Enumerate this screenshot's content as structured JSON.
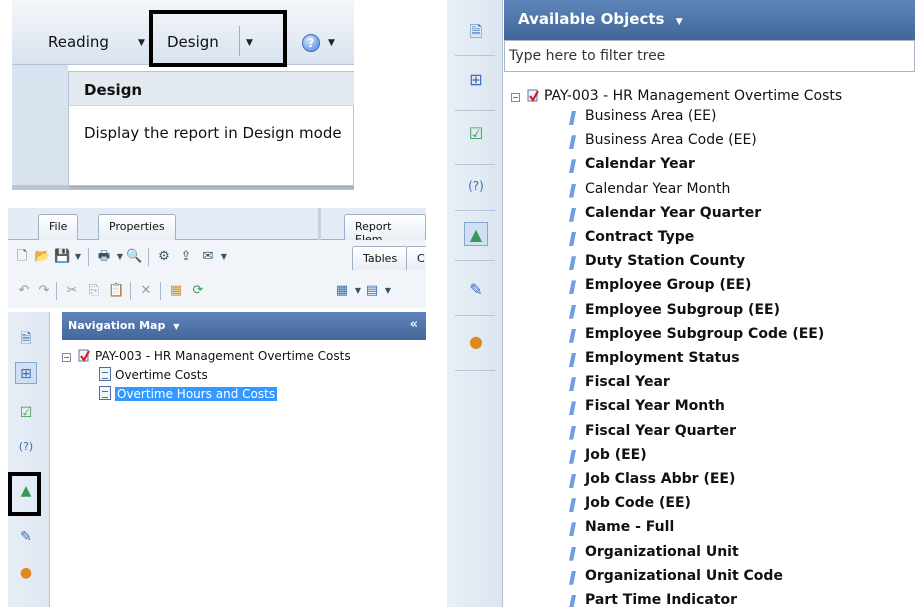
{
  "ribbon": {
    "reading_label": "Reading",
    "design_label": "Design",
    "tooltip_title": "Design",
    "tooltip_body": "Display the report in Design mode"
  },
  "left_panel": {
    "tabs": [
      "File",
      "Properties",
      "Report Elem",
      "Tables",
      "C"
    ],
    "nav_title": "Navigation Map",
    "tree": {
      "root": "PAY-003 - HR Management Overtime Costs",
      "children": [
        "Overtime Costs",
        "Overtime Hours and Costs"
      ],
      "selected_index": 1
    }
  },
  "right_panel": {
    "title": "Available Objects",
    "filter_placeholder": "Type here to filter tree",
    "root": "PAY-003 - HR Management Overtime Costs",
    "objects": [
      {
        "label": "Business Area (EE)",
        "bold": false
      },
      {
        "label": "Business Area Code (EE)",
        "bold": false
      },
      {
        "label": "Calendar Year",
        "bold": true
      },
      {
        "label": "Calendar Year Month",
        "bold": false
      },
      {
        "label": "Calendar Year Quarter",
        "bold": true
      },
      {
        "label": "Contract Type",
        "bold": true
      },
      {
        "label": "Duty Station County",
        "bold": true
      },
      {
        "label": "Employee Group (EE)",
        "bold": true
      },
      {
        "label": "Employee Subgroup (EE)",
        "bold": true
      },
      {
        "label": "Employee Subgroup Code (EE)",
        "bold": true
      },
      {
        "label": "Employment Status",
        "bold": true
      },
      {
        "label": "Fiscal Year",
        "bold": true
      },
      {
        "label": "Fiscal Year Month",
        "bold": true
      },
      {
        "label": "Fiscal Year Quarter",
        "bold": true
      },
      {
        "label": "Job (EE)",
        "bold": true
      },
      {
        "label": "Job Class Abbr (EE)",
        "bold": true
      },
      {
        "label": "Job Code (EE)",
        "bold": true
      },
      {
        "label": "Name - Full",
        "bold": true
      },
      {
        "label": "Organizational Unit",
        "bold": true
      },
      {
        "label": "Organizational Unit Code",
        "bold": true
      },
      {
        "label": "Part Time Indicator",
        "bold": true
      }
    ]
  },
  "colors": {
    "header_blue": "#4f74aa",
    "selection": "#3399ff",
    "highlight_box": "#000000"
  }
}
